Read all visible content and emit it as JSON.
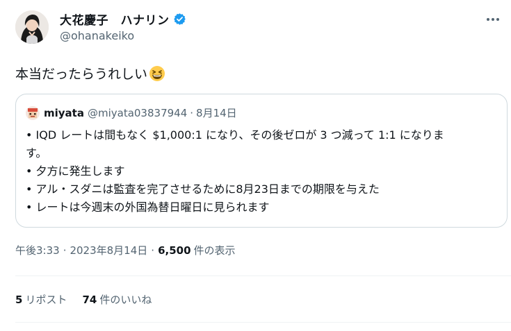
{
  "author": {
    "name": "大花慶子　ハナリン",
    "handle": "@ohanakeiko",
    "verified_icon": "verified-badge-icon",
    "verified_color": "#1d9bf0"
  },
  "tweet": {
    "text": "本当だったらうれしい",
    "emoji_icon": "grinning-squinting-face-icon"
  },
  "quote": {
    "name": "miyata",
    "handle": "@miyata03837944",
    "separator": "·",
    "date": "8月14日",
    "lines": [
      "• IQD レートは間もなく $1,000:1 になり、その後ゼロが 3 つ減って 1:1 になりま",
      "す。",
      "• 夕方に発生します",
      "• アル・スダニは監査を完了させるために8月23日までの期限を与えた",
      "• レートは今週末の外国為替日曜日に見られます"
    ]
  },
  "meta": {
    "time": "午後3:33",
    "dot1": "·",
    "date": "2023年8月14日",
    "dot2": "·",
    "views": "6,500",
    "views_label": "件の表示"
  },
  "stats": {
    "reposts": "5",
    "reposts_label": "リポスト",
    "likes": "74",
    "likes_label": "件のいいね"
  },
  "colors": {
    "text": "#0f1419",
    "secondary": "#536471",
    "border": "#cfd9de",
    "accent": "#1d9bf0"
  }
}
